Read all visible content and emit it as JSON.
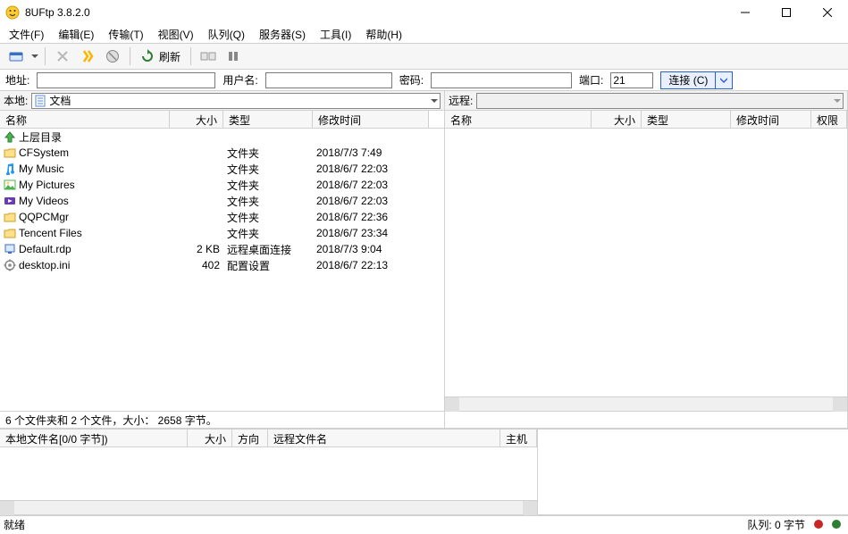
{
  "window": {
    "title": "8UFtp 3.8.2.0"
  },
  "menu": {
    "file": "文件(F)",
    "edit": "编辑(E)",
    "transfer": "传输(T)",
    "view": "视图(V)",
    "queue": "队列(Q)",
    "server": "服务器(S)",
    "tools": "工具(I)",
    "help": "帮助(H)"
  },
  "toolbar": {
    "refresh": "刷新"
  },
  "conn": {
    "addr_label": "地址:",
    "addr": "",
    "user_label": "用户名:",
    "user": "",
    "pass_label": "密码:",
    "pass": "",
    "port_label": "端口:",
    "port": "21",
    "connect": "连接 (C)"
  },
  "local": {
    "label": "本地:",
    "path": "文档",
    "cols": {
      "name": "名称",
      "size": "大小",
      "type": "类型",
      "date": "修改时间"
    },
    "rows": [
      {
        "icon": "up",
        "name": "上层目录",
        "size": "",
        "type": "",
        "date": ""
      },
      {
        "icon": "folder",
        "name": "CFSystem",
        "size": "",
        "type": "文件夹",
        "date": "2018/7/3 7:49"
      },
      {
        "icon": "music",
        "name": "My Music",
        "size": "",
        "type": "文件夹",
        "date": "2018/6/7 22:03"
      },
      {
        "icon": "picture",
        "name": "My Pictures",
        "size": "",
        "type": "文件夹",
        "date": "2018/6/7 22:03"
      },
      {
        "icon": "video",
        "name": "My Videos",
        "size": "",
        "type": "文件夹",
        "date": "2018/6/7 22:03"
      },
      {
        "icon": "folder",
        "name": "QQPCMgr",
        "size": "",
        "type": "文件夹",
        "date": "2018/6/7 22:36"
      },
      {
        "icon": "folder",
        "name": "Tencent Files",
        "size": "",
        "type": "文件夹",
        "date": "2018/6/7 23:34"
      },
      {
        "icon": "rdp",
        "name": "Default.rdp",
        "size": "2 KB",
        "type": "远程桌面连接",
        "date": "2018/7/3 9:04"
      },
      {
        "icon": "ini",
        "name": "desktop.ini",
        "size": "402",
        "type": "配置设置",
        "date": "2018/6/7 22:13"
      }
    ],
    "status": "6 个文件夹和 2 个文件，大小： 2658 字节。"
  },
  "remote": {
    "label": "远程:",
    "path": "",
    "cols": {
      "name": "名称",
      "size": "大小",
      "type": "类型",
      "date": "修改时间",
      "perm": "权限"
    }
  },
  "queue": {
    "cols": {
      "local": "本地文件名[0/0 字节])",
      "size": "大小",
      "dir": "方向",
      "remote": "远程文件名",
      "host": "主机"
    }
  },
  "status": {
    "ready": "就绪",
    "queue_bytes": "队列: 0 字节",
    "dot1": "#c62828",
    "dot2": "#2e7d32"
  },
  "icons": {
    "folder_fill": "#ffe08a",
    "folder_stroke": "#c9a227",
    "music_fill": "#2196f3",
    "picture_fill": "#4caf50",
    "video_fill": "#673ab7"
  }
}
